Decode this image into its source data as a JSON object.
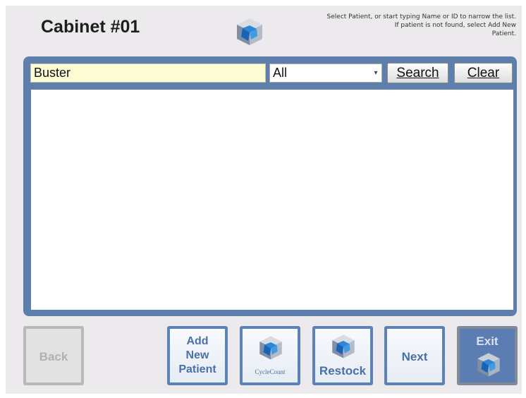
{
  "header": {
    "title": "Cabinet #01",
    "instructions_line1": "Select Patient, or start typing Name or ID to narrow the list.",
    "instructions_line2": "If patient is not found, select Add New",
    "instructions_line3": "Patient."
  },
  "search": {
    "value": "Buster",
    "filter_selected": "All",
    "search_label": "Search",
    "clear_label": "Clear"
  },
  "patient_list": {
    "items": []
  },
  "toolbar": {
    "back_label": "Back",
    "add_new_line1": "Add",
    "add_new_line2": "New",
    "add_new_line3": "Patient",
    "cyclecount_label": "CycleCount",
    "restock_label": "Restock",
    "next_label": "Next",
    "exit_label": "Exit"
  },
  "icons": {
    "logo": "cube-logo-icon",
    "cyclecount": "cube-icon",
    "restock": "cube-icon",
    "exit": "cube-icon"
  },
  "colors": {
    "panel": "#5e7fab",
    "accent": "#4a70a8",
    "search_field": "#fefcd4"
  }
}
